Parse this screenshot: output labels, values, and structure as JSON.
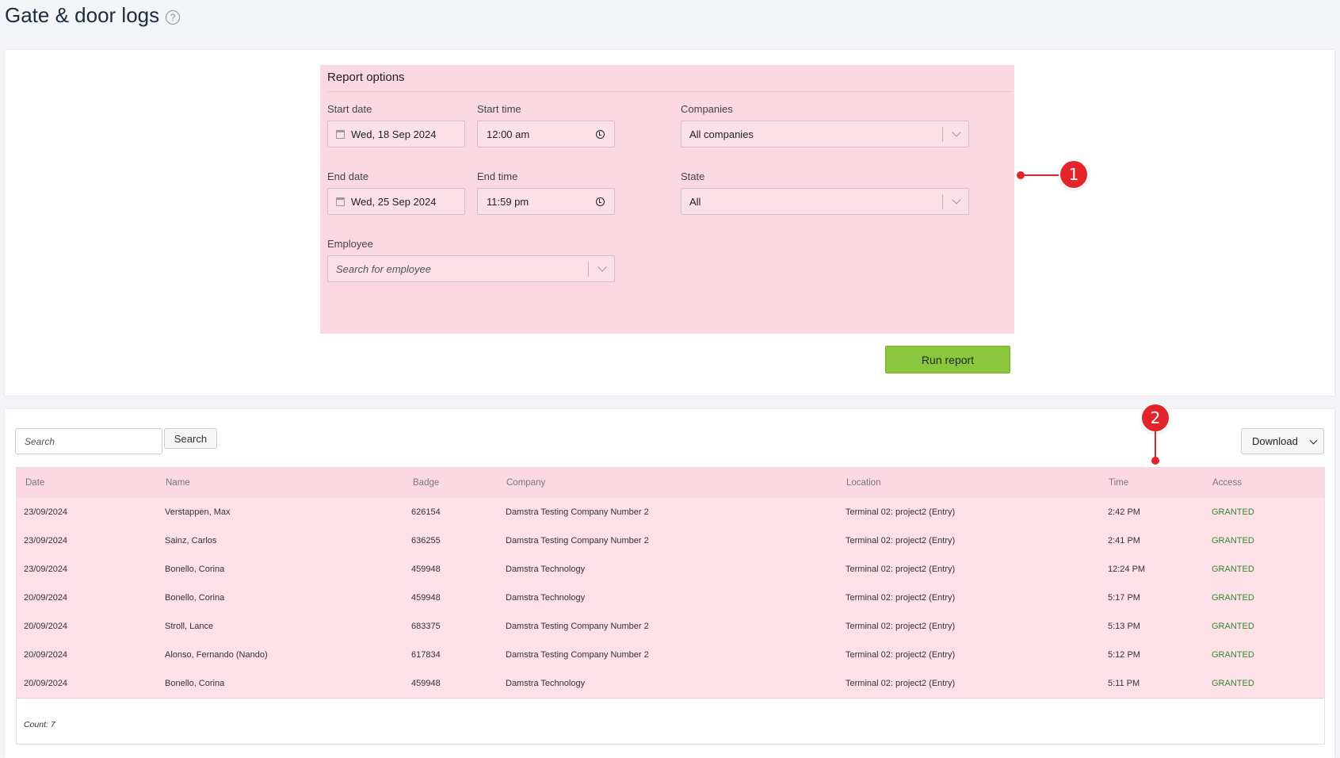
{
  "page": {
    "title": "Gate & door logs",
    "help_glyph": "?"
  },
  "report_options": {
    "title": "Report options",
    "start_date": {
      "label": "Start date",
      "value": "Wed, 18 Sep 2024"
    },
    "start_time": {
      "label": "Start time",
      "value": "12:00 am"
    },
    "end_date": {
      "label": "End date",
      "value": "Wed, 25 Sep 2024"
    },
    "end_time": {
      "label": "End time",
      "value": "11:59 pm"
    },
    "companies": {
      "label": "Companies",
      "value": "All companies"
    },
    "state": {
      "label": "State",
      "value": "All"
    },
    "employee": {
      "label": "Employee",
      "placeholder": "Search for employee"
    },
    "run_button": "Run report"
  },
  "markers": {
    "one": "1",
    "two": "2"
  },
  "toolbar": {
    "search_placeholder": "Search",
    "search_button": "Search",
    "download_button": "Download"
  },
  "table": {
    "columns": [
      "Date",
      "Name",
      "Badge",
      "Company",
      "Location",
      "Time",
      "Access"
    ],
    "rows": [
      [
        "23/09/2024",
        "Verstappen, Max",
        "626154",
        "Damstra Testing Company Number 2",
        "Terminal 02: project2 (Entry)",
        "2:42 PM",
        "GRANTED"
      ],
      [
        "23/09/2024",
        "Sainz, Carlos",
        "636255",
        "Damstra Testing Company Number 2",
        "Terminal 02: project2 (Entry)",
        "2:41 PM",
        "GRANTED"
      ],
      [
        "23/09/2024",
        "Bonello, Corina",
        "459948",
        "Damstra Technology",
        "Terminal 02: project2 (Entry)",
        "12:24 PM",
        "GRANTED"
      ],
      [
        "20/09/2024",
        "Bonello, Corina",
        "459948",
        "Damstra Technology",
        "Terminal 02: project2 (Entry)",
        "5:17 PM",
        "GRANTED"
      ],
      [
        "20/09/2024",
        "Stroll, Lance",
        "683375",
        "Damstra Testing Company Number 2",
        "Terminal 02: project2 (Entry)",
        "5:13 PM",
        "GRANTED"
      ],
      [
        "20/09/2024",
        "Alonso, Fernando (Nando)",
        "617834",
        "Damstra Testing Company Number 2",
        "Terminal 02: project2 (Entry)",
        "5:12 PM",
        "GRANTED"
      ],
      [
        "20/09/2024",
        "Bonello, Corina",
        "459948",
        "Damstra Technology",
        "Terminal 02: project2 (Entry)",
        "5:11 PM",
        "GRANTED"
      ]
    ],
    "count": "Count: 7"
  },
  "colors": {
    "highlight": "#fbd9e3",
    "run_button": "#8cc63f",
    "marker": "#e3242b",
    "granted": "#2e8b2e"
  }
}
